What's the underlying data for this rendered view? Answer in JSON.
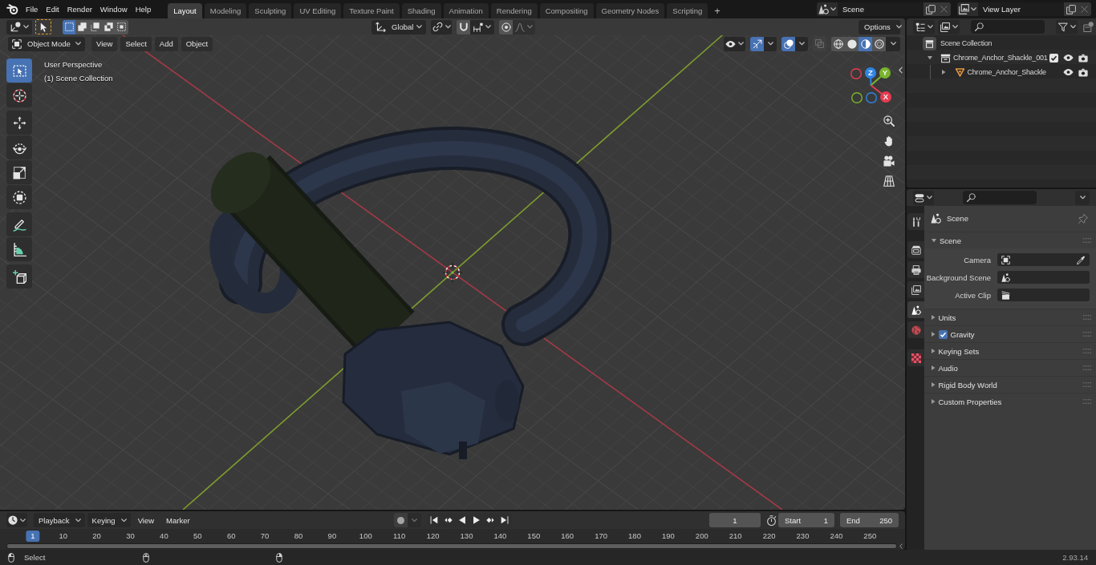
{
  "topbar": {
    "menus": [
      "File",
      "Edit",
      "Render",
      "Window",
      "Help"
    ],
    "workspaces": [
      {
        "label": "Layout",
        "selected": true
      },
      {
        "label": "Modeling",
        "selected": false
      },
      {
        "label": "Sculpting",
        "selected": false
      },
      {
        "label": "UV Editing",
        "selected": false
      },
      {
        "label": "Texture Paint",
        "selected": false
      },
      {
        "label": "Shading",
        "selected": false
      },
      {
        "label": "Animation",
        "selected": false
      },
      {
        "label": "Rendering",
        "selected": false
      },
      {
        "label": "Compositing",
        "selected": false
      },
      {
        "label": "Geometry Nodes",
        "selected": false
      },
      {
        "label": "Scripting",
        "selected": false
      }
    ],
    "add_workspace": "+",
    "scene": "Scene",
    "view_layer": "View Layer"
  },
  "tool_header": {
    "select_modes": [
      {
        "kind": "set",
        "selected": true
      },
      {
        "kind": "extend",
        "selected": false
      },
      {
        "kind": "subtract",
        "selected": false
      },
      {
        "kind": "invert",
        "selected": false
      },
      {
        "kind": "intersect",
        "selected": false
      }
    ],
    "orientation": "Global",
    "snapping": false,
    "proportional_editing": false,
    "options": "Options"
  },
  "viewport_header": {
    "mode": "Object Mode",
    "menus": [
      "View",
      "Select",
      "Add",
      "Object"
    ],
    "show_gizmos": true,
    "show_overlays": true,
    "xray": false,
    "shading_modes": [
      {
        "kind": "wireframe",
        "selected": false
      },
      {
        "kind": "solid",
        "selected": false
      },
      {
        "kind": "material",
        "selected": true
      },
      {
        "kind": "rendered",
        "selected": false
      }
    ]
  },
  "viewport": {
    "view_name": "User Perspective",
    "collection": "(1) Scene Collection",
    "tool_groups": [
      {
        "tools": [
          {
            "kind": "select-box",
            "selected": true
          },
          {
            "kind": "cursor",
            "selected": false
          }
        ]
      },
      {
        "tools": [
          {
            "kind": "move",
            "selected": false
          },
          {
            "kind": "rotate",
            "selected": false
          },
          {
            "kind": "scale",
            "selected": false
          },
          {
            "kind": "transform",
            "selected": false
          }
        ]
      },
      {
        "tools": [
          {
            "kind": "annotate",
            "selected": false
          },
          {
            "kind": "measure",
            "selected": false
          }
        ]
      },
      {
        "tools": [
          {
            "kind": "add-cube",
            "selected": false
          }
        ]
      }
    ],
    "gizmo_axes": [
      {
        "label": "Z",
        "color": "#2f84e4"
      },
      {
        "label": "Y",
        "color": "#79b52c"
      },
      {
        "label": "X",
        "color": "#e63c52"
      }
    ]
  },
  "outliner": {
    "items": [
      {
        "label": "Scene Collection",
        "kind": "scene-collection",
        "children": [
          {
            "label": "Chrome_Anchor_Shackle_001",
            "kind": "collection",
            "expanded": true,
            "checked": true,
            "visible": true,
            "renderable": true,
            "children": [
              {
                "label": "Chrome_Anchor_Shackle",
                "kind": "mesh",
                "expanded": false,
                "visible": true,
                "renderable": true
              }
            ]
          }
        ]
      }
    ]
  },
  "properties": {
    "tab_groups": [
      {
        "tabs": [
          {
            "kind": "tool",
            "selected": false
          }
        ]
      },
      {
        "tabs": [
          {
            "kind": "render",
            "selected": false
          },
          {
            "kind": "output",
            "selected": false
          },
          {
            "kind": "view-layer",
            "selected": false
          },
          {
            "kind": "scene",
            "selected": true
          },
          {
            "kind": "world",
            "selected": false
          }
        ]
      },
      {
        "tabs": [
          {
            "kind": "texture",
            "selected": false
          }
        ]
      }
    ],
    "context": "Scene",
    "panels": [
      {
        "label": "Scene",
        "kind": "panel",
        "expanded": true,
        "fields": [
          {
            "label": "Camera",
            "kind": "camera"
          },
          {
            "label": "Background Scene",
            "kind": "scene"
          },
          {
            "label": "Active Clip",
            "kind": "clip"
          }
        ]
      },
      {
        "label": "Units",
        "kind": "panel",
        "expanded": false
      },
      {
        "label": "Gravity",
        "kind": "checkbox-panel",
        "expanded": false,
        "checked": true
      },
      {
        "label": "Keying Sets",
        "kind": "panel",
        "expanded": false
      },
      {
        "label": "Audio",
        "kind": "panel",
        "expanded": false
      },
      {
        "label": "Rigid Body World",
        "kind": "panel",
        "expanded": false
      },
      {
        "label": "Custom Properties",
        "kind": "panel",
        "expanded": false
      }
    ]
  },
  "timeline": {
    "menus": [
      {
        "label": "Playback",
        "kind": "dropdown"
      },
      {
        "label": "Keying",
        "kind": "dropdown"
      },
      {
        "label": "View",
        "kind": "menu"
      },
      {
        "label": "Marker",
        "kind": "menu"
      }
    ],
    "auto_keying": false,
    "current_frame": "1",
    "start_label": "Start",
    "start": "1",
    "end_label": "End",
    "end": "250",
    "frames": [
      {
        "label": "1",
        "selected": true
      },
      {
        "label": "10",
        "selected": false
      },
      {
        "label": "20",
        "selected": false
      },
      {
        "label": "30",
        "selected": false
      },
      {
        "label": "40",
        "selected": false
      },
      {
        "label": "50",
        "selected": false
      },
      {
        "label": "60",
        "selected": false
      },
      {
        "label": "70",
        "selected": false
      },
      {
        "label": "80",
        "selected": false
      },
      {
        "label": "90",
        "selected": false
      },
      {
        "label": "100",
        "selected": false
      },
      {
        "label": "110",
        "selected": false
      },
      {
        "label": "120",
        "selected": false
      },
      {
        "label": "130",
        "selected": false
      },
      {
        "label": "140",
        "selected": false
      },
      {
        "label": "150",
        "selected": false
      },
      {
        "label": "160",
        "selected": false
      },
      {
        "label": "170",
        "selected": false
      },
      {
        "label": "180",
        "selected": false
      },
      {
        "label": "190",
        "selected": false
      },
      {
        "label": "200",
        "selected": false
      },
      {
        "label": "210",
        "selected": false
      },
      {
        "label": "220",
        "selected": false
      },
      {
        "label": "230",
        "selected": false
      },
      {
        "label": "240",
        "selected": false
      },
      {
        "label": "250",
        "selected": false
      }
    ]
  },
  "status_bar": {
    "hint": "Select",
    "version": "2.93.14"
  }
}
